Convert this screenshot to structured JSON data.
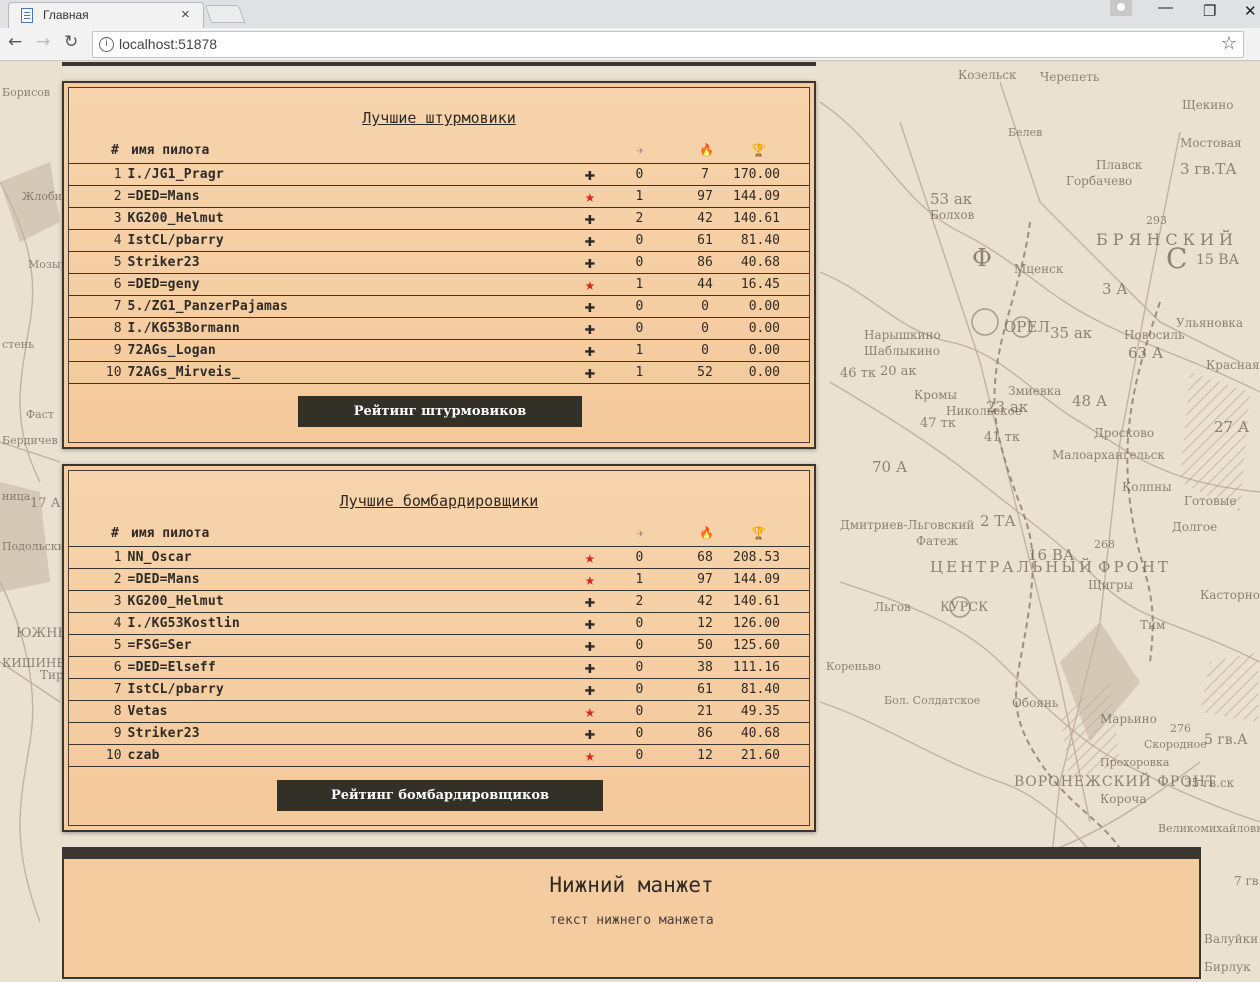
{
  "browser": {
    "tab_title": "Главная",
    "tab_close": "×",
    "url": "localhost:51878",
    "nav": {
      "back": "←",
      "forward": "→",
      "reload": "↻"
    },
    "window_controls": {
      "minimize": "—",
      "maximize": "❐",
      "close": "✕"
    },
    "icons": {
      "info": "i",
      "star": "☆"
    }
  },
  "map_labels": [
    "Козельск",
    "Черепеть",
    "Щекино",
    "Белев",
    "Мостовая",
    "Плавск",
    "Горбачево",
    "3 гв.ТА",
    "53 ак",
    "Болхов",
    "293",
    "БРЯНСКИЙ",
    "Ф",
    "Мценск",
    "С",
    "15 ВА",
    "3 А",
    "ОРЕЛ",
    "35 ак",
    "Новосиль",
    "63 А",
    "Ульяновка",
    "Красная",
    "Наpышкино",
    "Шаблыкино",
    "46 тк",
    "20 ак",
    "47 тк",
    "41 тк",
    "23 ак",
    "Кромы",
    "Змиевка",
    "Никольское",
    "48 А",
    "27 А",
    "Дросково",
    "Малоархангельск",
    "70 А",
    "Колпны",
    "Готовые",
    "Дмитриев-Льговский",
    "Фатеж",
    "2 ТА",
    "ЦЕНТРАЛЬНЫЙ",
    "ФРОНТ",
    "268",
    "16 ВА",
    "Щигры",
    "Долгое",
    "Касторное",
    "КУРСК",
    "Тим",
    "Льгов",
    "Кореньво",
    "Бол. Солдатское",
    "Обоянь",
    "Марьино",
    "276",
    "Скородное",
    "5 гв.А",
    "ВОРОНЕЖСКИЙ ФРОНТ",
    "35 гв.ск",
    "Великомихайловка",
    "Прохоровка",
    "Корочa",
    "7 гв.А",
    "Валуйки",
    "Бирлук",
    "Борисов",
    "Жлоби",
    "Мозыр",
    "стень",
    "Фаст",
    "Бердичев",
    "ница",
    "17 А",
    "Подольский",
    "КИШИНЕВ",
    "ЮЖНЫ",
    "Тир"
  ],
  "attack": {
    "title": "Лучшие штурмовики",
    "header": {
      "hash": "#",
      "name": "имя пилота"
    },
    "header_icons": [
      "plane-icon",
      "fire-icon",
      "trophy-icon"
    ],
    "button": "Рейтинг штурмовиков",
    "rows": [
      {
        "pos": "1",
        "name": "I./JG1_Pragr",
        "side": "axis",
        "a": "0",
        "b": "7",
        "c": "170.00"
      },
      {
        "pos": "2",
        "name": "=DED=Mans",
        "side": "allied",
        "a": "1",
        "b": "97",
        "c": "144.09"
      },
      {
        "pos": "3",
        "name": "KG200_Helmut",
        "side": "axis",
        "a": "2",
        "b": "42",
        "c": "140.61"
      },
      {
        "pos": "4",
        "name": "IstCL/pbarry",
        "side": "axis",
        "a": "0",
        "b": "61",
        "c": "81.40"
      },
      {
        "pos": "5",
        "name": "Striker23",
        "side": "axis",
        "a": "0",
        "b": "86",
        "c": "40.68"
      },
      {
        "pos": "6",
        "name": "=DED=geny",
        "side": "allied",
        "a": "1",
        "b": "44",
        "c": "16.45"
      },
      {
        "pos": "7",
        "name": "5./ZG1_PanzerPajamas",
        "side": "axis",
        "a": "0",
        "b": "0",
        "c": "0.00"
      },
      {
        "pos": "8",
        "name": "I./KG53Bormann",
        "side": "axis",
        "a": "0",
        "b": "0",
        "c": "0.00"
      },
      {
        "pos": "9",
        "name": "72AGs_Logan",
        "side": "axis",
        "a": "1",
        "b": "0",
        "c": "0.00"
      },
      {
        "pos": "10",
        "name": "72AGs_Mirveis_",
        "side": "axis",
        "a": "1",
        "b": "52",
        "c": "0.00"
      }
    ]
  },
  "bomber": {
    "title": "Лучшие бомбардировщики",
    "header": {
      "hash": "#",
      "name": "имя пилота"
    },
    "header_icons": [
      "plane-icon",
      "fire-icon",
      "trophy-icon"
    ],
    "button": "Рейтинг бомбардировщиков",
    "rows": [
      {
        "pos": "1",
        "name": "NN_Oscar",
        "side": "allied",
        "a": "0",
        "b": "68",
        "c": "208.53"
      },
      {
        "pos": "2",
        "name": "=DED=Mans",
        "side": "allied",
        "a": "1",
        "b": "97",
        "c": "144.09"
      },
      {
        "pos": "3",
        "name": "KG200_Helmut",
        "side": "axis",
        "a": "2",
        "b": "42",
        "c": "140.61"
      },
      {
        "pos": "4",
        "name": "I./KG53Kostlin",
        "side": "axis",
        "a": "0",
        "b": "12",
        "c": "126.00"
      },
      {
        "pos": "5",
        "name": "=FSG=Ser",
        "side": "axis",
        "a": "0",
        "b": "50",
        "c": "125.60"
      },
      {
        "pos": "6",
        "name": "=DED=Elseff",
        "side": "axis",
        "a": "0",
        "b": "38",
        "c": "111.16"
      },
      {
        "pos": "7",
        "name": "IstCL/pbarry",
        "side": "axis",
        "a": "0",
        "b": "61",
        "c": "81.40"
      },
      {
        "pos": "8",
        "name": "Vetas",
        "side": "allied",
        "a": "0",
        "b": "21",
        "c": "49.35"
      },
      {
        "pos": "9",
        "name": "Striker23",
        "side": "axis",
        "a": "0",
        "b": "86",
        "c": "40.68"
      },
      {
        "pos": "10",
        "name": "czab",
        "side": "allied",
        "a": "0",
        "b": "12",
        "c": "21.60"
      }
    ]
  },
  "footer": {
    "title": "Нижний манжет",
    "text": "текст нижнего манжета"
  },
  "colors": {
    "panel": "#f5cba0",
    "border": "#3a3632",
    "allied": "#d8281f",
    "button": "#333028"
  }
}
